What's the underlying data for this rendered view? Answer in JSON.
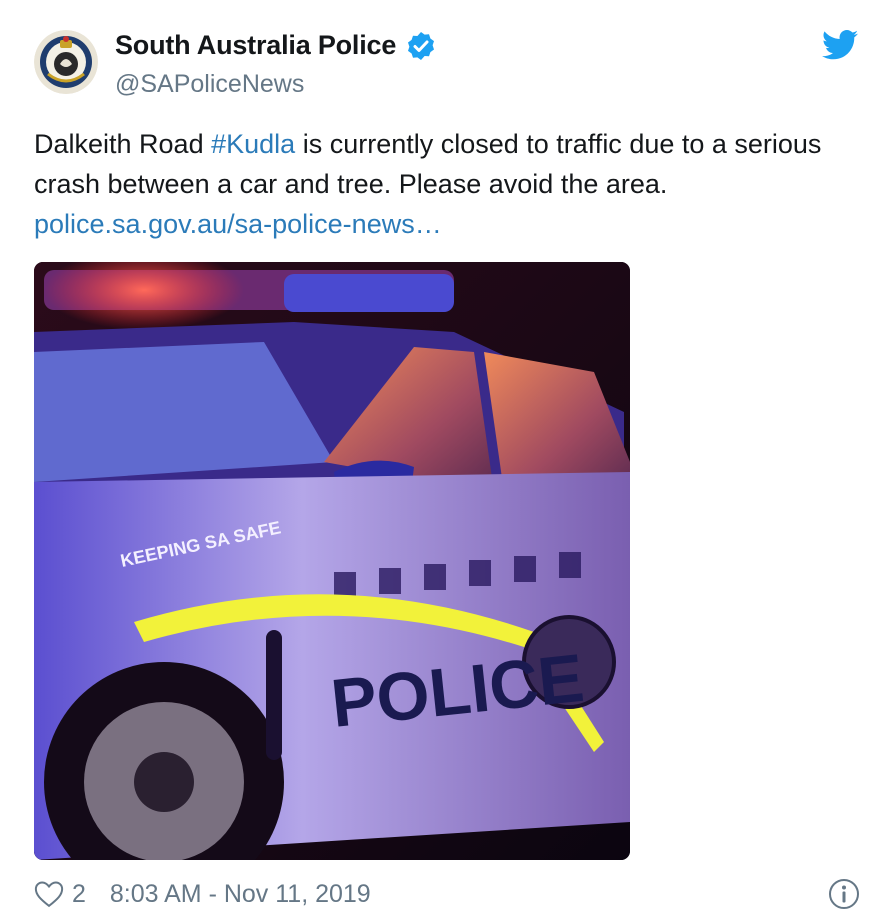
{
  "author": {
    "display_name": "South Australia Police",
    "handle": "@SAPoliceNews",
    "avatar_icon": "sa-police-badge-icon",
    "verified_icon": "verified-badge-icon"
  },
  "platform_icon": "twitter-bird-icon",
  "tweet": {
    "text_before": "Dalkeith Road ",
    "hashtag": "#Kudla",
    "text_after": " is currently closed to traffic due to a serious crash between a car and tree. Please avoid the area.",
    "link": "police.sa.gov.au/sa-police-news…"
  },
  "media": {
    "description_icon": "police-car-photo",
    "car_text_keeping": "KEEPING SA SAFE",
    "car_text_police": "POLICE"
  },
  "footer": {
    "like_icon": "heart-icon",
    "like_count": "2",
    "timestamp": "8:03 AM - Nov 11, 2019",
    "info_icon": "info-icon"
  },
  "colors": {
    "link": "#2b7bb9",
    "secondary_text": "#657786",
    "twitter_blue": "#1da1f2"
  }
}
